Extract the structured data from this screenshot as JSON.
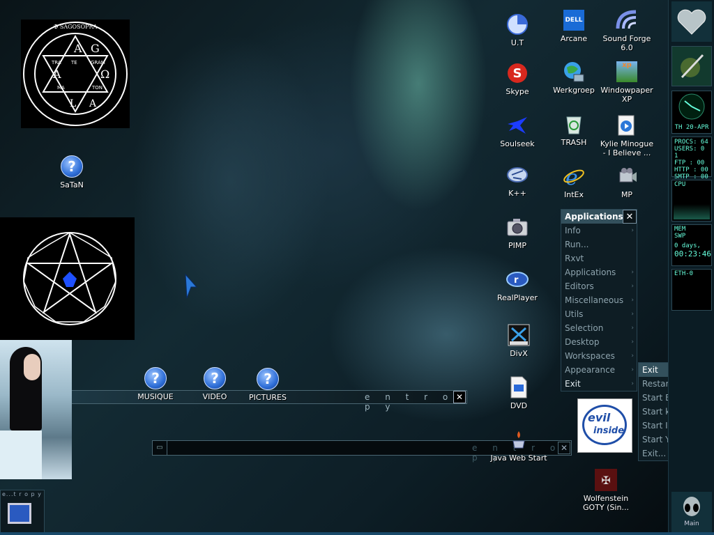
{
  "desktop": {
    "icons": {
      "satan": "SaTaN",
      "musique": "MUSIQUE",
      "video": "VIDEO",
      "pictures": "PICTURES",
      "ut": "U.T",
      "arcane": "Arcane",
      "sound_forge": "Sound Forge 6.0",
      "skype": "Skype",
      "werkgroep": "Werkgroep",
      "windowpaper": "Windowpaper XP",
      "soulseek": "Soulseek",
      "trash": "TRASH",
      "kylie": "Kylie Minogue - I Believe ...",
      "kpp": "K++",
      "intex": "IntEx",
      "mp": "MP",
      "pimp": "PIMP",
      "realplayer": "RealPlayer",
      "divx": "DivX",
      "dvd": "DVD",
      "java": "Java Web Start",
      "wolfenstein": "Wolfenstein GOTY (Sin..."
    },
    "seal_text": {
      "top": "✠ SAGOSOPRA",
      "letters": [
        "A",
        "G",
        "A",
        "Ω",
        "L",
        "A",
        "TE",
        "TRA",
        "GRAM",
        "MA",
        "TON"
      ]
    },
    "evil_inside": {
      "line1": "evil",
      "line2": "inside"
    }
  },
  "app_menu": {
    "title": "Applications",
    "close": "✕",
    "items": [
      {
        "label": "Info",
        "sub": true
      },
      {
        "label": "Run...",
        "sub": false
      },
      {
        "label": "Rxvt",
        "sub": false
      },
      {
        "label": "Applications",
        "sub": true
      },
      {
        "label": "Editors",
        "sub": true
      },
      {
        "label": "Miscellaneous",
        "sub": true
      },
      {
        "label": "Utils",
        "sub": true
      },
      {
        "label": "Selection",
        "sub": true
      },
      {
        "label": "Desktop",
        "sub": true
      },
      {
        "label": "Workspaces",
        "sub": true
      },
      {
        "label": "Appearance",
        "sub": true
      },
      {
        "label": "Exit",
        "sub": true
      }
    ]
  },
  "exit_menu": {
    "title": "Exit",
    "items": [
      "Restart",
      "Start BlackBox",
      "Start kwm",
      "Start IceWM",
      "Start Yawm",
      "Exit..."
    ]
  },
  "bars": {
    "entropy_label": "e n t r o p y",
    "entropy_label2": "e n t r o p y",
    "close": "✕",
    "small_window": "▭"
  },
  "dock": {
    "date": "TH 20-APR",
    "procs": "PROCS: 64",
    "users": "USERS: 0 1",
    "ftp": "FTP  : 00",
    "http": "HTTP : 00",
    "smtp": "SMTP : 00",
    "cpu": "CPU",
    "mem": "MEM",
    "swp": "SWP",
    "uptime_days": "0 days,",
    "uptime_time": "00:23:46",
    "eth": "ETH-0",
    "main": "Main"
  },
  "taskbar": {
    "label": "e...t r o p y"
  }
}
